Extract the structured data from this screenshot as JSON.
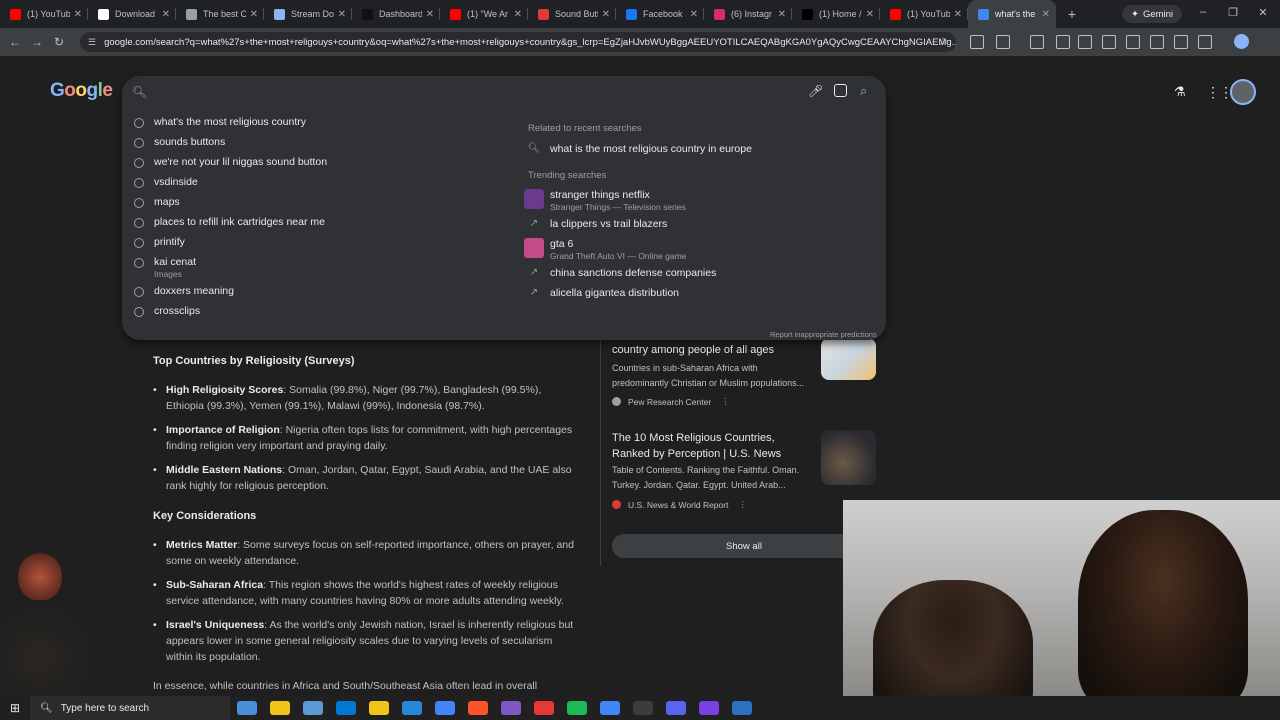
{
  "browser": {
    "tabs": [
      {
        "label": "(1) YouTub",
        "color": "#ff0000",
        "active": false
      },
      {
        "label": "Download",
        "color": "#ffffff",
        "active": false
      },
      {
        "label": "The best Cl",
        "color": "#9aa0a6",
        "active": false
      },
      {
        "label": "Stream Do",
        "color": "#8ab4f8",
        "active": false
      },
      {
        "label": "Dashboard",
        "color": "#111111",
        "active": false
      },
      {
        "label": "(1) \"We Ar",
        "color": "#ff0000",
        "active": false
      },
      {
        "label": "Sound Butt",
        "color": "#e53935",
        "active": false
      },
      {
        "label": "Facebook",
        "color": "#1877f2",
        "active": false
      },
      {
        "label": "(6) Instagr",
        "color": "#d62976",
        "active": false
      },
      {
        "label": "(1) Home /",
        "color": "#000000",
        "active": false
      },
      {
        "label": "(1) YouTub",
        "color": "#ff0000",
        "active": false
      },
      {
        "label": "what's the",
        "color": "#4285f4",
        "active": true
      }
    ],
    "new_tab_symbol": "+",
    "gemini_label": "Gemini",
    "url": "google.com/search?q=what%27s+the+most+religouys+country&oq=what%27s+the+most+religouys+country&gs_lcrp=EgZjaHJvbWUyBggAEEUYOTILCAEQABgKGA0YgAQyCwgCEAAYChgNGIAEMg..."
  },
  "google": {
    "logo_letters": [
      {
        "ch": "G",
        "color": "#8ab4f8"
      },
      {
        "ch": "o",
        "color": "#f28b82"
      },
      {
        "ch": "o",
        "color": "#fdd663"
      },
      {
        "ch": "g",
        "color": "#8ab4f8"
      },
      {
        "ch": "l",
        "color": "#81c995"
      },
      {
        "ch": "e",
        "color": "#f28b82"
      }
    ],
    "search": {
      "value": "",
      "recent": [
        {
          "text": "what's the most religious country",
          "sub": ""
        },
        {
          "text": "sounds buttons",
          "sub": ""
        },
        {
          "text": "we're not your lil niggas sound button",
          "sub": ""
        },
        {
          "text": "vsdinside",
          "sub": ""
        },
        {
          "text": "maps",
          "sub": ""
        },
        {
          "text": "places to refill ink cartridges near me",
          "sub": ""
        },
        {
          "text": "printify",
          "sub": ""
        },
        {
          "text": "kai cenat",
          "sub": "Images"
        },
        {
          "text": "doxxers meaning",
          "sub": ""
        },
        {
          "text": "crossclips",
          "sub": ""
        }
      ],
      "related_heading": "Related to recent searches",
      "related": [
        {
          "text": "what is the most religious country in europe"
        }
      ],
      "trending_heading": "Trending searches",
      "trending": [
        {
          "text": "stranger things netflix",
          "sub": "Stranger Things — Television series",
          "thumb": "#6b3a8c"
        },
        {
          "text": "la clippers vs trail blazers",
          "sub": "",
          "thumb": ""
        },
        {
          "text": "gta 6",
          "sub": "Grand Theft Auto VI — Online game",
          "thumb": "#c44a8a"
        },
        {
          "text": "china sanctions defense companies",
          "sub": "",
          "thumb": ""
        },
        {
          "text": "alicella gigantea distribution",
          "sub": "",
          "thumb": ""
        }
      ],
      "report_label": "Report inappropriate predictions"
    },
    "results": {
      "heading1": "Top Countries by Religiosity (Surveys)",
      "bullets1": [
        {
          "bold": "High Religiosity Scores",
          "text": ": Somalia (99.8%), Niger (99.7%), Bangladesh (99.5%), Ethiopia (99.3%), Yemen (99.1%), Malawi (99%), Indonesia (98.7%)."
        },
        {
          "bold": "Importance of Religion",
          "text": ": Nigeria often tops lists for commitment, with high percentages finding religion very important and praying daily."
        },
        {
          "bold": "Middle Eastern Nations",
          "text": ": Oman, Jordan, Qatar, Egypt, Saudi Arabia, and the UAE also rank highly for religious perception."
        }
      ],
      "heading2": "Key Considerations",
      "bullets2": [
        {
          "bold": "Metrics Matter",
          "text": ": Some surveys focus on self-reported importance, others on prayer, and some on weekly attendance."
        },
        {
          "bold": "Sub-Saharan Africa",
          "text": ": This region shows the world's highest rates of weekly religious service attendance, with many countries having 80% or more adults attending weekly."
        },
        {
          "bold": "Israel's Uniqueness",
          "text": ": As the world's only Jewish nation, Israel is inherently religious but appears lower in some general religiosity scales due to varying levels of secularism within its population."
        }
      ],
      "essence": "In essence, while countries in Africa and South/Southeast Asia often lead in overall"
    },
    "sources": [
      {
        "title": "country among people of all ages",
        "snippet": "Countries in sub-Saharan Africa with predominantly Christian or Muslim populations...",
        "source": "Pew Research Center",
        "dot_color": "#9aa0a6"
      },
      {
        "title": "The 10 Most Religious Countries, Ranked by Perception | U.S. News",
        "snippet": "Table of Contents. Ranking the Faithful. Oman. Turkey. Jordan. Qatar. Egypt. United Arab...",
        "source": "U.S. News & World Report",
        "dot_color": "#e53935"
      }
    ],
    "show_all_label": "Show all"
  },
  "taskbar": {
    "search_placeholder": "Type here to search",
    "apps": [
      "#4a90d9",
      "#f0c419",
      "#5b9bd5",
      "#0078d4",
      "#f0c419",
      "#2b88d8",
      "#4285f4",
      "#fb542b",
      "#7e57c2",
      "#e53935",
      "#1db954",
      "#4285f4",
      "#3c3c3c",
      "#5865f2",
      "#7b3fe4",
      "#2f6fbf"
    ]
  }
}
